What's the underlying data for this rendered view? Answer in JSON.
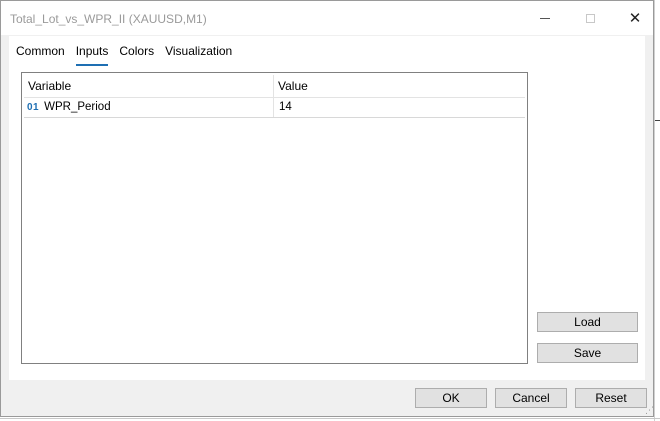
{
  "window": {
    "title": "Total_Lot_vs_WPR_II (XAUUSD,M1)",
    "close_glyph": "✕"
  },
  "tabs": [
    {
      "label": "Common",
      "active": false
    },
    {
      "label": "Inputs",
      "active": true
    },
    {
      "label": "Colors",
      "active": false
    },
    {
      "label": "Visualization",
      "active": false
    }
  ],
  "grid": {
    "headers": {
      "variable": "Variable",
      "value": "Value"
    },
    "rows": [
      {
        "type_icon": "01",
        "type_icon_name": "integer-type-icon",
        "variable": "WPR_Period",
        "value": "14"
      }
    ]
  },
  "side_buttons": {
    "load": "Load",
    "save": "Save"
  },
  "bottom_buttons": {
    "ok": "OK",
    "cancel": "Cancel",
    "reset": "Reset"
  },
  "colors": {
    "accent": "#1e6fb3",
    "dialog_bg": "#f0f0f0",
    "button_bg": "#e1e1e1"
  }
}
